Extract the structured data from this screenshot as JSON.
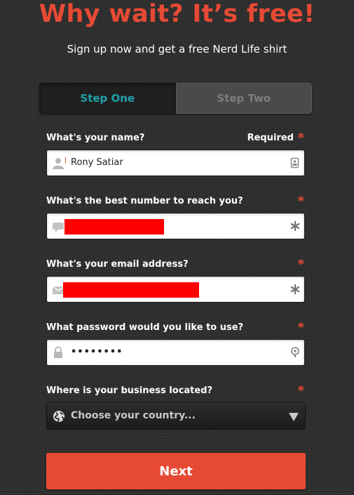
{
  "header": {
    "title": "Why wait? It’s free!",
    "subtitle": "Sign up now and get a free Nerd Life shirt"
  },
  "steps": [
    {
      "label": "Step One",
      "active": true
    },
    {
      "label": "Step Two",
      "active": false
    }
  ],
  "form": {
    "required_label": "Required",
    "required_marker": "*",
    "name": {
      "label": "What's your name?",
      "value": "Rony Satiar",
      "icon_left": "user-icon",
      "icon_right": "contact-card-icon"
    },
    "phone": {
      "label": "What's the best number to reach you?",
      "value_redacted": true,
      "icon_left": "chat-bubble-icon",
      "icon_right": "asterisk-icon"
    },
    "email": {
      "label": "What's your email address?",
      "value_redacted": true,
      "icon_left": "envelope-icon",
      "icon_right": "asterisk-icon"
    },
    "password": {
      "label": "What password would you like to use?",
      "value": "••••••••",
      "icon_left": "lock-icon",
      "icon_right": "key-icon"
    },
    "country": {
      "label": "Where is your business located?",
      "placeholder": "Choose your country...",
      "icon_left": "globe-icon",
      "icon_right": "dropdown-arrow-icon"
    }
  },
  "submit_label": "Next",
  "colors": {
    "accent": "#e64a34",
    "active_step": "#1ea3a8",
    "redaction": "#ff0000"
  }
}
